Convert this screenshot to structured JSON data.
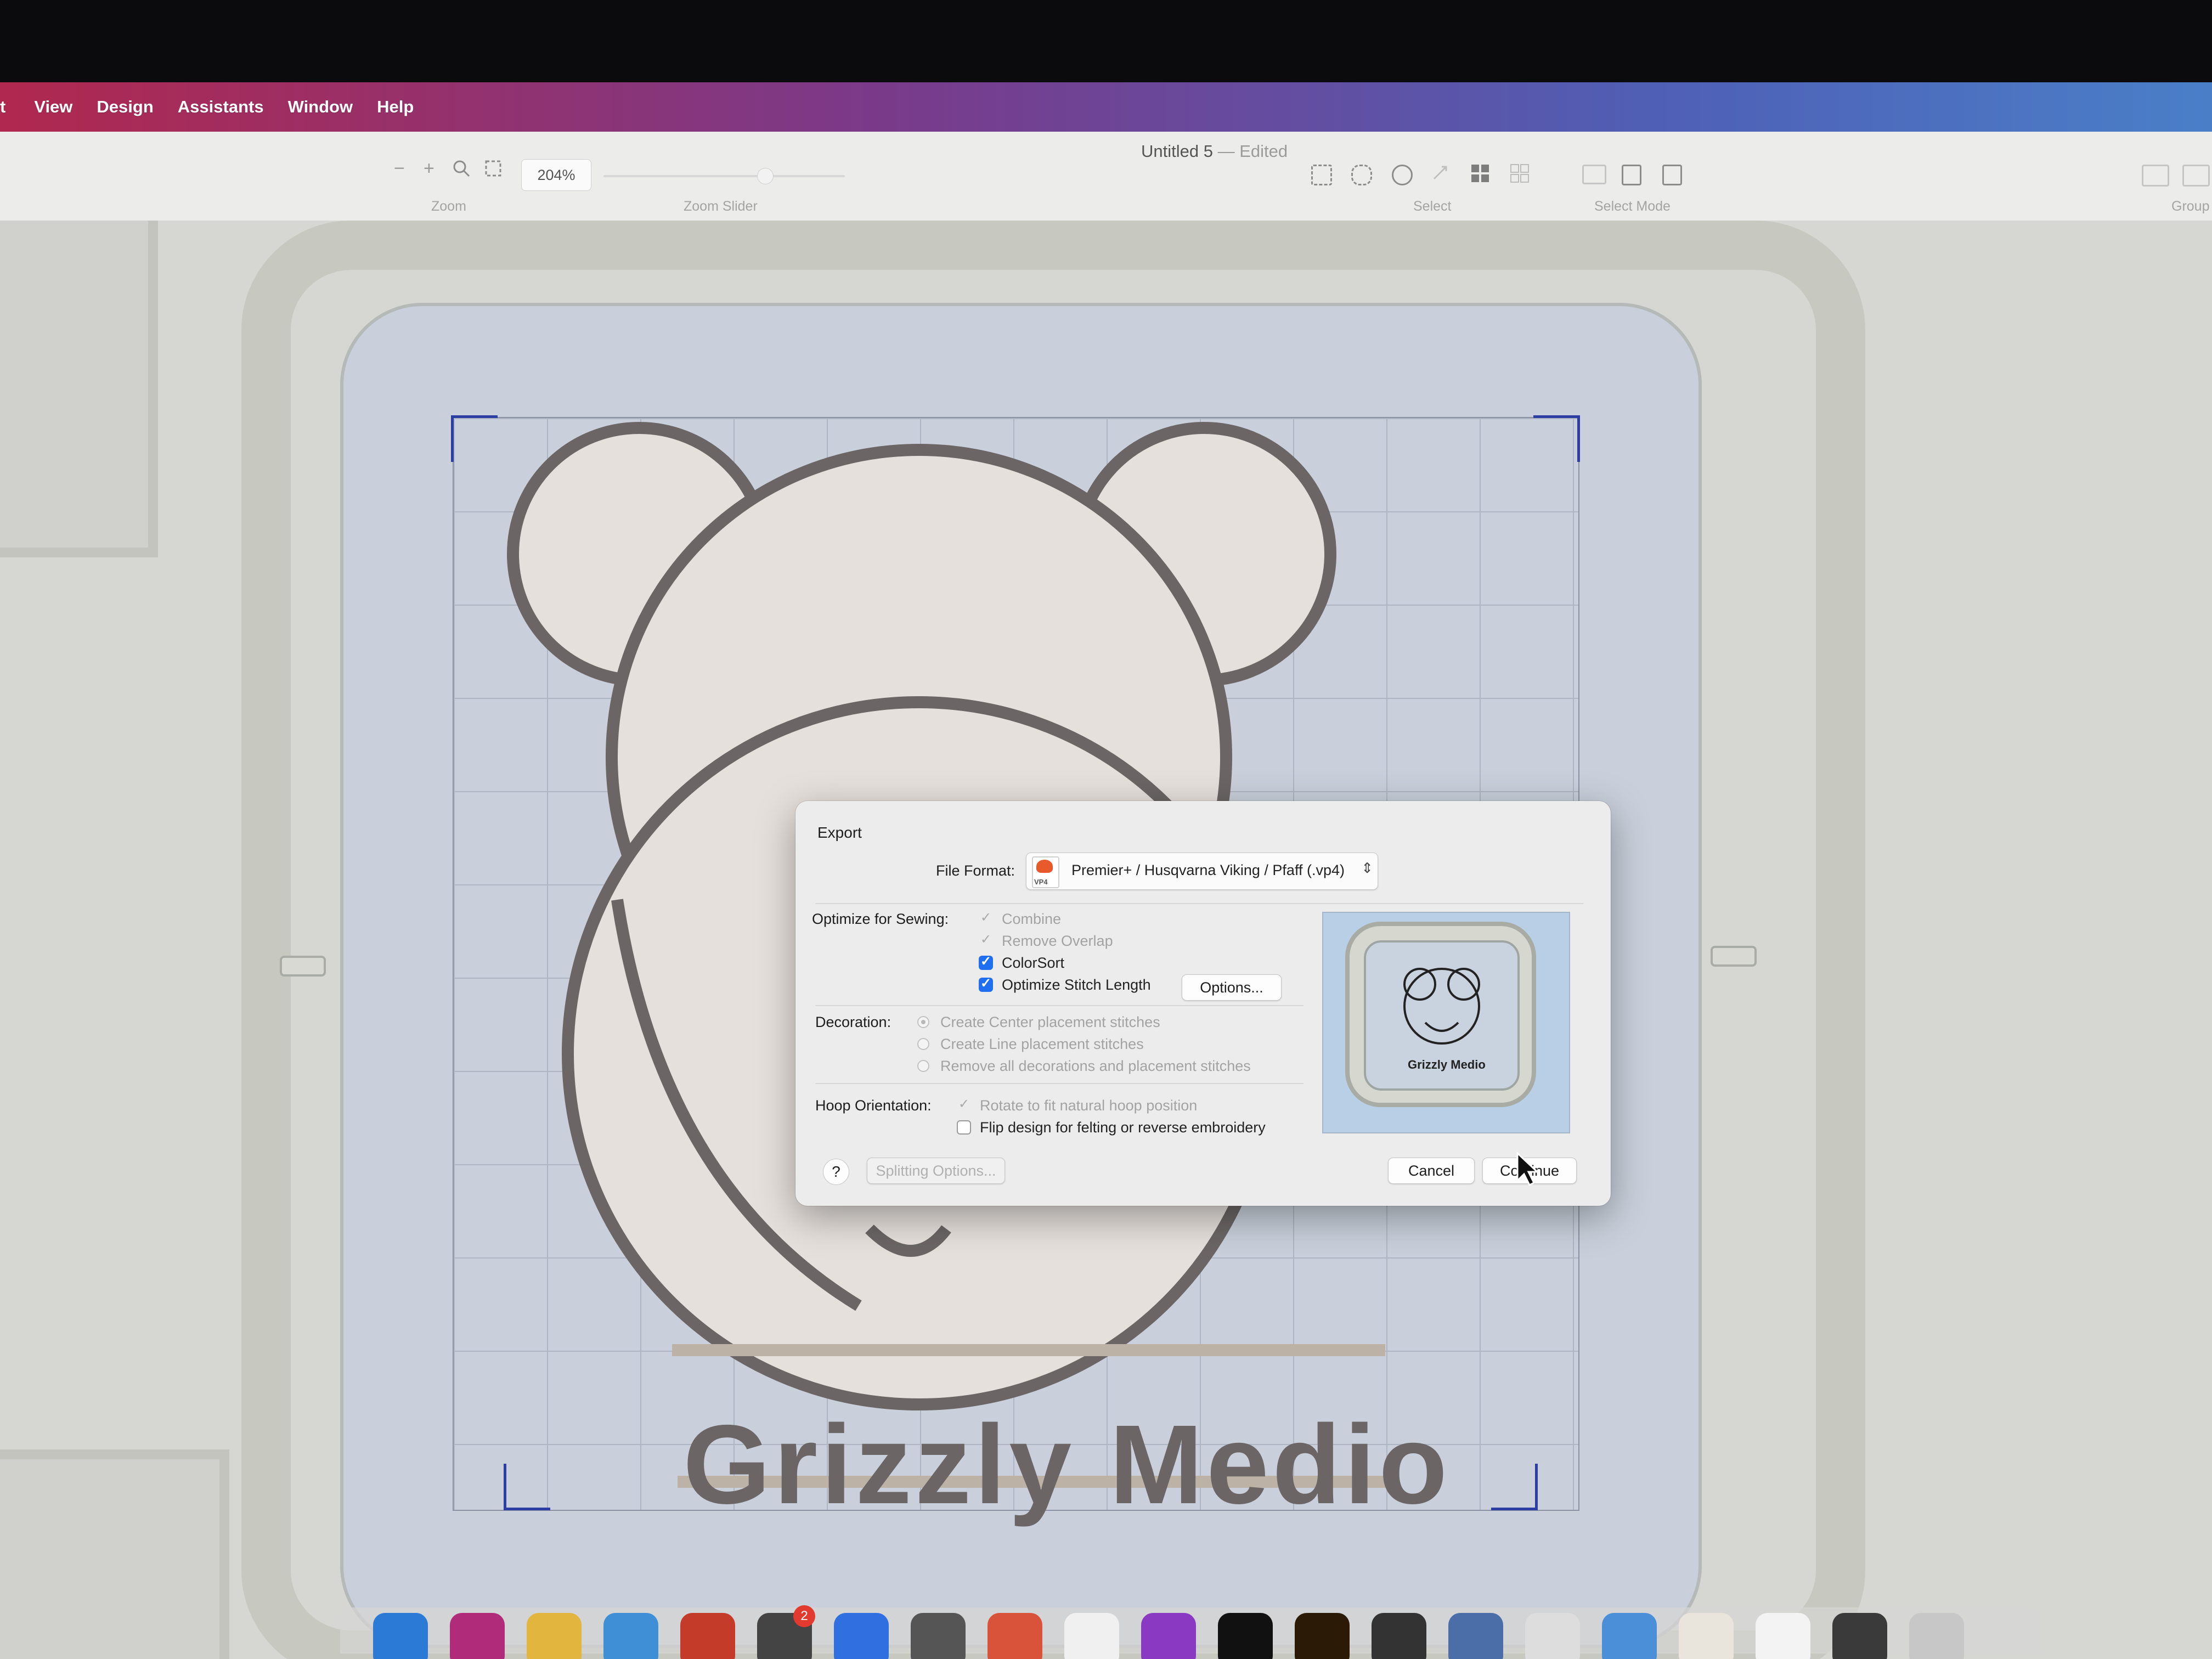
{
  "menubar": {
    "items": [
      "t",
      "View",
      "Design",
      "Assistants",
      "Window",
      "Help"
    ]
  },
  "toolbar": {
    "document_title": "Untitled 5",
    "document_status": "— Edited",
    "zoom_out": "−",
    "zoom_in": "+",
    "zoom_value": "204%",
    "zoom_label": "Zoom",
    "zoom_slider_label": "Zoom Slider",
    "select_label": "Select",
    "select_mode_label": "Select Mode",
    "group_label": "Group"
  },
  "design": {
    "logo_text": "Grizzly Medio"
  },
  "dialog": {
    "title": "Export",
    "file_format_label": "File Format:",
    "file_format_value": "Premier+ / Husqvarna Viking / Pfaff (.vp4)",
    "file_format_icon_text": "VP4",
    "optimize_label": "Optimize for Sewing:",
    "optimize_options": [
      {
        "label": "Combine",
        "state": "disabled-checked"
      },
      {
        "label": "Remove Overlap",
        "state": "disabled-checked"
      },
      {
        "label": "ColorSort",
        "state": "checked"
      },
      {
        "label": "Optimize Stitch Length",
        "state": "checked"
      }
    ],
    "options_button": "Options...",
    "decoration_label": "Decoration:",
    "decoration_options": [
      {
        "label": "Create Center placement stitches",
        "selected": true
      },
      {
        "label": "Create Line placement stitches",
        "selected": false
      },
      {
        "label": "Remove all decorations and placement stitches",
        "selected": false
      }
    ],
    "hoop_label": "Hoop Orientation:",
    "hoop_options": [
      {
        "label": "Rotate to fit natural hoop position",
        "state": "disabled-checked"
      },
      {
        "label": "Flip design for felting or reverse embroidery",
        "state": "unchecked"
      }
    ],
    "preview_text": "Grizzly Medio",
    "help_button": "?",
    "splitting_button": "Splitting Options...",
    "cancel_button": "Cancel",
    "continue_button": "Continue"
  },
  "dock": {
    "badge_count": "2"
  },
  "colors": {
    "accent": "#1f6ff0",
    "stitch": "#6b6665",
    "hoop_bg": "#c9d0db"
  }
}
